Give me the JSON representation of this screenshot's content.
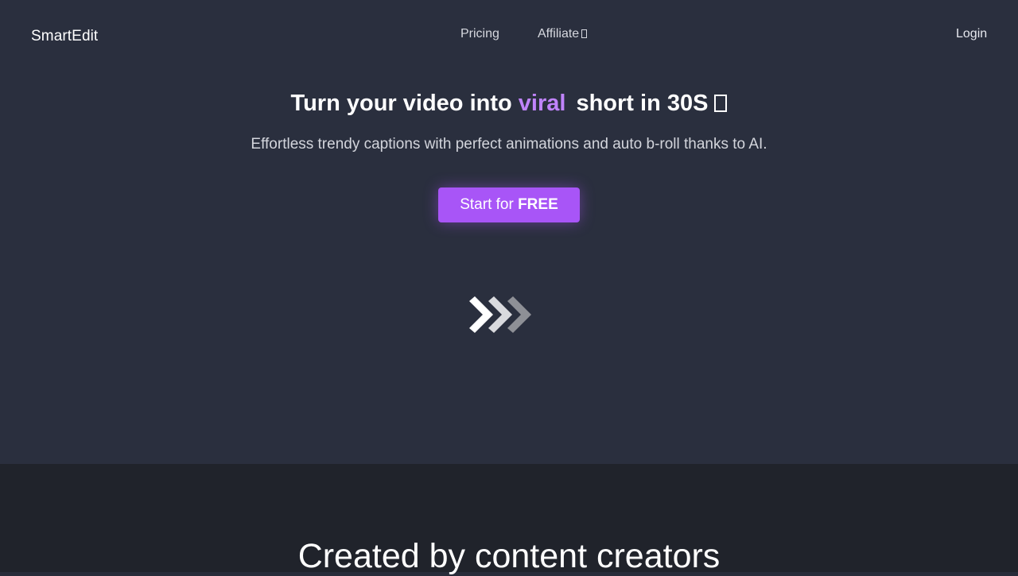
{
  "nav": {
    "brand": "SmartEdit",
    "links": [
      {
        "label": "Pricing"
      },
      {
        "label": "Affiliate"
      }
    ],
    "login": "Login"
  },
  "hero": {
    "headline_before": "Turn your video into",
    "headline_highlight": "viral",
    "headline_after": "short in 30S",
    "subheadline": "Effortless trendy captions with perfect animations and auto b-roll thanks to AI.",
    "cta_prefix": "Start for",
    "cta_emphasis": "FREE",
    "icon": "triple-chevron-right-icon"
  },
  "section2": {
    "title": "Created by content creators"
  },
  "colors": {
    "hero_bg": "#2a2f3e",
    "section_bg": "#20232b",
    "accent": "#a855f7",
    "highlight": "#c084fc"
  }
}
